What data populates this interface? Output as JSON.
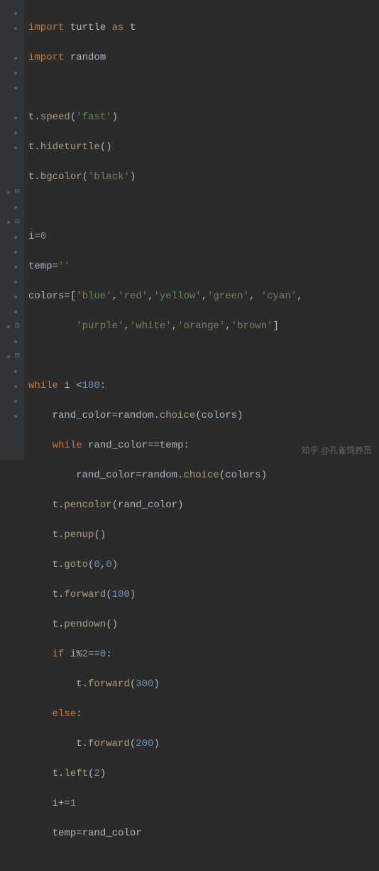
{
  "code": {
    "l1": {
      "import": "import",
      "turtle": "turtle",
      "as": "as",
      "t": "t"
    },
    "l2": {
      "import": "import",
      "random": "random"
    },
    "l3": "",
    "l4": {
      "pre": "t.",
      "fn": "speed",
      "open": "(",
      "arg": "'fast'",
      "close": ")"
    },
    "l5": {
      "pre": "t.",
      "fn": "hideturtle",
      "open": "()",
      "close": ""
    },
    "l6": {
      "pre": "t.",
      "fn": "bgcolor",
      "open": "(",
      "arg": "'black'",
      "close": ")"
    },
    "l7": "",
    "l8": {
      "lhs": "i",
      "eq": "=",
      "rhs": "0"
    },
    "l9": {
      "lhs": "temp",
      "eq": "=",
      "rhs": "''"
    },
    "l10": {
      "lhs": "colors",
      "eq": "=[",
      "a": "'blue'",
      "c1": ",",
      "b": "'red'",
      "c2": ",",
      "c": "'yellow'",
      "c3": ",",
      "d": "'green'",
      "c4": ", ",
      "e": "'cyan'",
      "c5": ","
    },
    "l11": {
      "pad": "        ",
      "a": "'purple'",
      "c1": ",",
      "b": "'white'",
      "c2": ",",
      "c": "'orange'",
      "c3": ",",
      "d": "'brown'",
      "close": "]"
    },
    "l12": "",
    "l13": {
      "kw": "while",
      "sp": " ",
      "v": "i ",
      "op": "<",
      "n": "180",
      "col": ":"
    },
    "l14": {
      "ind": "    ",
      "lhs": "rand_color",
      "eq": "=",
      "mod": "random.",
      "fn": "choice",
      "open": "(",
      "arg": "colors",
      "close": ")"
    },
    "l15": {
      "ind": "    ",
      "kw": "while",
      "sp": " ",
      "a": "rand_color",
      "op": "==",
      "b": "temp",
      "col": ":"
    },
    "l16": {
      "ind": "        ",
      "lhs": "rand_color",
      "eq": "=",
      "mod": "random.",
      "fn": "choice",
      "open": "(",
      "arg": "colors",
      "close": ")"
    },
    "l17": {
      "ind": "    ",
      "pre": "t.",
      "fn": "pencolor",
      "open": "(",
      "arg": "rand_color",
      "close": ")"
    },
    "l18": {
      "ind": "    ",
      "pre": "t.",
      "fn": "penup",
      "open": "()"
    },
    "l19": {
      "ind": "    ",
      "pre": "t.",
      "fn": "goto",
      "open": "(",
      "a": "0",
      "c": ",",
      "b": "0",
      "close": ")"
    },
    "l20": {
      "ind": "    ",
      "pre": "t.",
      "fn": "forward",
      "open": "(",
      "arg": "100",
      "close": ")"
    },
    "l21": {
      "ind": "    ",
      "pre": "t.",
      "fn": "pendown",
      "open": "()"
    },
    "l22": {
      "ind": "    ",
      "kw": "if",
      "sp": " ",
      "expr": "i%",
      "n": "2",
      "op2": "==",
      "n2": "0",
      "col": ":"
    },
    "l23": {
      "ind": "        ",
      "pre": "t.",
      "fn": "forward",
      "open": "(",
      "arg": "300",
      "close": ")"
    },
    "l24": {
      "ind": "    ",
      "kw": "else",
      "col": ":"
    },
    "l25": {
      "ind": "        ",
      "pre": "t.",
      "fn": "forward",
      "open": "(",
      "arg": "200",
      "close": ")"
    },
    "l26": {
      "ind": "    ",
      "pre": "t.",
      "fn": "left",
      "open": "(",
      "arg": "2",
      "close": ")"
    },
    "l27": {
      "ind": "    ",
      "lhs": "i",
      "op": "+=",
      "rhs": "1"
    },
    "l28": {
      "ind": "    ",
      "lhs": "temp",
      "eq": "=",
      "rhs": "rand_color"
    }
  },
  "watermark": "知乎 @孔雀饲养员"
}
